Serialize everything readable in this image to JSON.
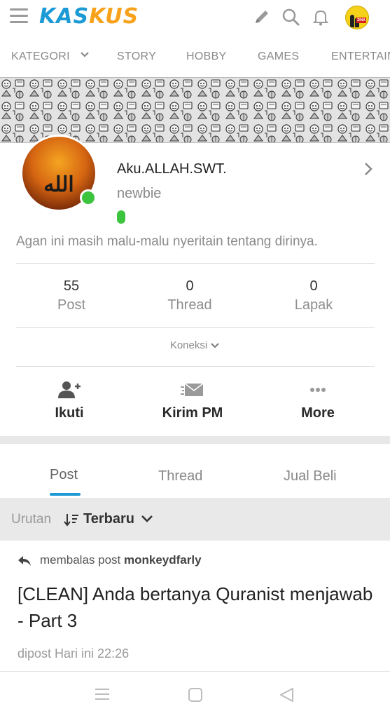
{
  "app": {
    "logo_part1": "KAS",
    "logo_part2": "KUS",
    "brand_blue": "#1c9ad6",
    "brand_orange": "#f7a21a"
  },
  "topbar": {
    "icons": [
      "menu-icon",
      "pencil-icon",
      "search-icon",
      "bell-icon",
      "user-avatar"
    ]
  },
  "categories": [
    {
      "label": "KATEGORI",
      "has_dropdown": true
    },
    {
      "label": "STORY"
    },
    {
      "label": "HOBBY"
    },
    {
      "label": "GAMES"
    },
    {
      "label": "ENTERTAIN"
    }
  ],
  "profile": {
    "username": "Aku.ALLAH.SWT.",
    "rank": "newbie",
    "online_color": "#3cc43f",
    "bio": "Agan ini masih malu-malu nyeritain tentang dirinya."
  },
  "stats": [
    {
      "value": "55",
      "label": "Post"
    },
    {
      "value": "0",
      "label": "Thread"
    },
    {
      "value": "0",
      "label": "Lapak"
    }
  ],
  "koneksi": "Koneksi",
  "actions": [
    {
      "label": "Ikuti",
      "icon": "add-user-icon"
    },
    {
      "label": "Kirim PM",
      "icon": "send-mail-icon"
    },
    {
      "label": "More",
      "icon": "more-dots-icon"
    }
  ],
  "profile_tabs": [
    {
      "label": "Post",
      "active": true
    },
    {
      "label": "Thread",
      "active": false
    },
    {
      "label": "Jual Beli",
      "active": false
    }
  ],
  "sort": {
    "label": "Urutan",
    "value": "Terbaru"
  },
  "post": {
    "reply_prefix": "membalas post",
    "reply_user": "monkeydfarly",
    "title": "[CLEAN] Anda bertanya Quranist menjawab - Part 3",
    "meta": "dipost Hari ini 22:26"
  }
}
